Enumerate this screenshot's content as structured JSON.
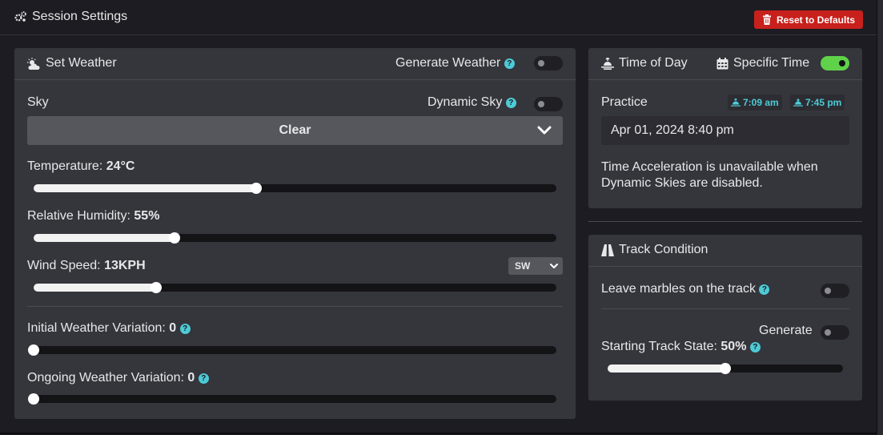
{
  "header": {
    "title": "Session Settings",
    "reset_label": "Reset to Defaults"
  },
  "weather": {
    "title": "Set Weather",
    "generate_label": "Generate Weather",
    "generate_on": false,
    "sky_label": "Sky",
    "dynamic_sky_label": "Dynamic Sky",
    "dynamic_sky_on": false,
    "sky_value": "Clear",
    "temperature_label": "Temperature:",
    "temperature_value": "24°C",
    "temperature_level": 0.425,
    "humidity_label": "Relative Humidity:",
    "humidity_value": "55%",
    "humidity_level": 0.27,
    "wind_label": "Wind Speed:",
    "wind_value": "13KPH",
    "wind_level": 0.235,
    "wind_dir": "SW",
    "initial_variation_label": "Initial Weather Variation:",
    "initial_variation_value": "0",
    "initial_variation_level": 0,
    "ongoing_variation_label": "Ongoing Weather Variation:",
    "ongoing_variation_value": "0",
    "ongoing_variation_level": 0
  },
  "time": {
    "title": "Time of Day",
    "specific_label": "Specific Time",
    "specific_on": true,
    "session": "Practice",
    "sunrise": "7:09 am",
    "sunset": "7:45 pm",
    "datetime": "Apr 01, 2024 8:40 pm",
    "acceleration_note": "Time Acceleration is unavailable when Dynamic Skies are disabled."
  },
  "track": {
    "title": "Track Condition",
    "marbles_label": "Leave marbles on the track",
    "marbles_on": false,
    "generate_label": "Generate",
    "generate_on": false,
    "state_label": "Starting Track State:",
    "state_value": "50%",
    "state_level": 0.5
  },
  "colors": {
    "accent": "#4dcbd6",
    "toggle_on": "#5fd24a",
    "danger": "#c8201c"
  }
}
